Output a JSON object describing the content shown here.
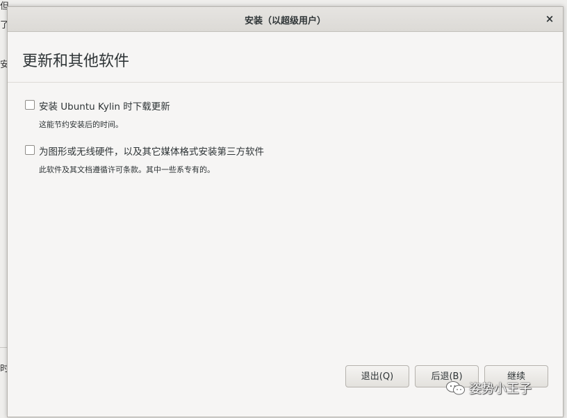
{
  "background": {
    "edge_fragments": [
      "但",
      "了",
      "安",
      "时"
    ]
  },
  "window": {
    "title": "安装（以超级用户）",
    "close_glyph": "×"
  },
  "page": {
    "title": "更新和其他软件"
  },
  "options": [
    {
      "label": "安装 Ubuntu Kylin 时下载更新",
      "description": "这能节约安装后的时间。",
      "checked": false
    },
    {
      "label": "为图形或无线硬件，以及其它媒体格式安装第三方软件",
      "description": "此软件及其文档遵循许可条款。其中一些系专有的。",
      "checked": false
    }
  ],
  "buttons": {
    "quit": "退出(Q)",
    "back": "后退(B)",
    "continue": "继续"
  },
  "watermark": {
    "icon": "wechat-icon",
    "text": "姿势小王子"
  },
  "colors": {
    "window_bg": "#f6f5f4",
    "titlebar_bg": "#dcdad6",
    "text": "#2e3436"
  }
}
